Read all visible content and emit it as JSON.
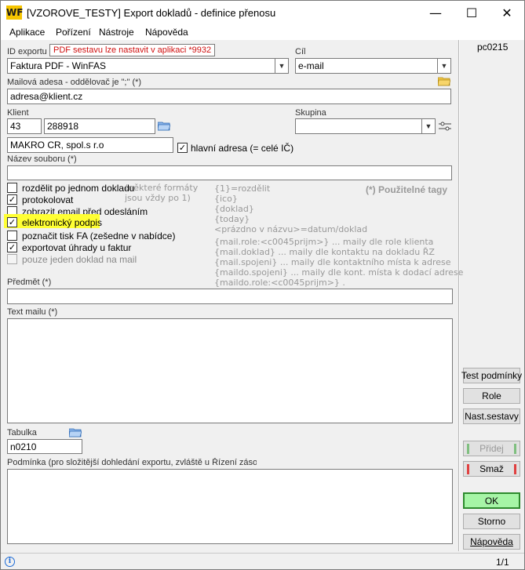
{
  "window": {
    "title": "[VZOROVE_TESTY] Export dokladů - definice přenosu",
    "logo_text": "WF",
    "minimize": "—",
    "maximize": "☐",
    "close": "✕"
  },
  "menu": {
    "items": [
      "Aplikace",
      "Pořízení",
      "Nástroje",
      "Nápověda"
    ]
  },
  "header": {
    "code": "pc0215"
  },
  "form": {
    "id_label": "ID exportu",
    "tooltip": "PDF sestavu lze nastavit v aplikaci *9932",
    "id_value": "Faktura PDF - WinFAS",
    "cil_label": "Cíl",
    "cil_value": "e-mail",
    "mail_label": "Mailová adesa - oddělovač je \";\" (*)",
    "mail_value": "adresa@klient.cz",
    "klient_label": "Klient",
    "klient_code": "43",
    "klient_number": "288918",
    "skupina_label": "Skupina",
    "skupina_value": "",
    "klient_name": "MAKRO CR, spol.s r.o",
    "hlavni_adresa_label": "hlavní adresa (= celé IČ)",
    "hlavni_adresa_checked": true,
    "nazev_label": "Název souboru (*)",
    "nazev_value": "",
    "options": [
      {
        "label": "rozdělit po jednom dokladu",
        "checked": false,
        "disabled": false
      },
      {
        "label": "protokolovat",
        "checked": true,
        "disabled": false
      },
      {
        "label": "zobrazit email před odesláním",
        "checked": false,
        "disabled": false
      },
      {
        "label": "elektronický podpis",
        "checked": true,
        "disabled": false
      },
      {
        "label": "poznačit tisk FA (zešedne v nabídce)",
        "checked": false,
        "disabled": false
      },
      {
        "label": "exportovat úhrady u faktur",
        "checked": true,
        "disabled": false
      },
      {
        "label": "pouze jeden doklad na mail",
        "checked": false,
        "disabled": true
      }
    ],
    "hint_line1": "(některé formáty",
    "hint_line2": "jsou vždy po 1)",
    "tags_title": "(*) Použitelné tagy",
    "tags": [
      "{1}=rozdělit",
      "{ico}",
      "{doklad}",
      "{today}",
      "<prázdno v názvu>=datum/doklad"
    ],
    "mail_tags": [
      "{mail.role:<c0045prijm>} ... maily dle role klienta",
      "{mail.doklad} ... maily dle kontaktu na dokladu ŘZ",
      "{mail.spojeni} ... maily dle kontaktního místa k adrese",
      "{maildo.spojeni} ... maily dle kont. místa k dodací adrese",
      "{maildo.role:<c0045prijm>} ."
    ],
    "predmet_label": "Předmět (*)",
    "predmet_value": "",
    "text_label": "Text mailu (*)",
    "text_value": "",
    "tabulka_label": "Tabulka",
    "tabulka_value": "n0210",
    "podminka_label": "Podmínka (pro složitější dohledání exportu, zvláště u Řízení zásob)",
    "podminka_value": ""
  },
  "buttons": {
    "test": "Test podmínky",
    "role": "Role",
    "nast": "Nast.sestavy",
    "pridej": "Přidej",
    "smaz": "Smaž",
    "ok": "OK",
    "storno": "Storno",
    "napoveda": "Nápověda"
  },
  "status": {
    "info": "i",
    "page": "1/1"
  },
  "colors": {
    "highlight": "#ffff33",
    "ok_green": "#a6f5a6",
    "tooltip_text": "#d01010"
  }
}
